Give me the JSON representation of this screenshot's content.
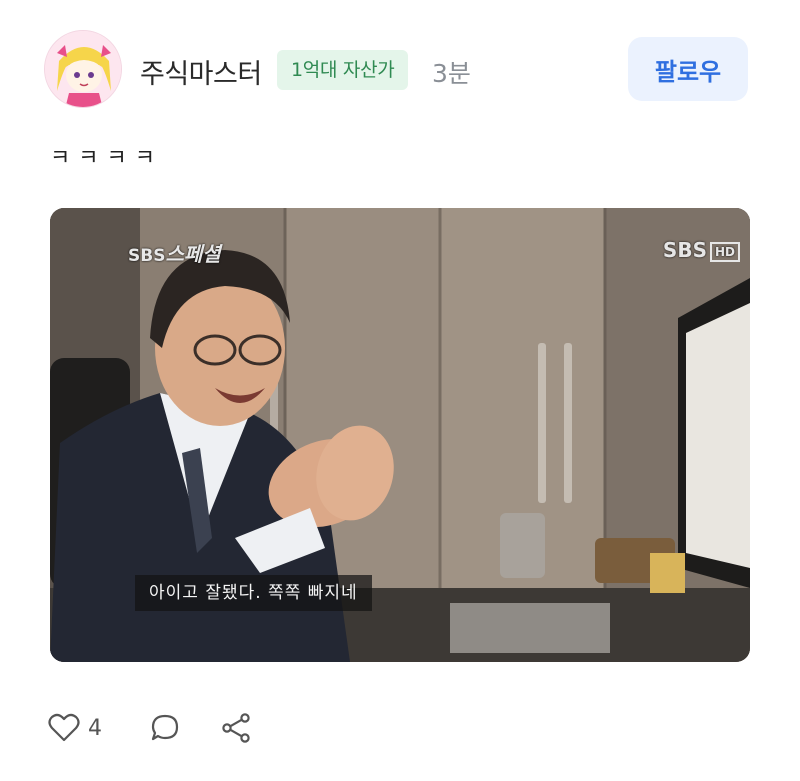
{
  "post": {
    "author": "주식마스터",
    "badge": "1억대 자산가",
    "time": "3분",
    "follow_label": "팔로우",
    "text": "ㅋㅋㅋㅋ"
  },
  "media": {
    "logo_left_main": "SBS",
    "logo_left_script": "스페셜",
    "logo_right_main": "SBS",
    "logo_right_hd": "HD",
    "subtitle": "아이고 잘됐다. 쪽쪽 빠지네"
  },
  "actions": {
    "like_count": "4",
    "like_icon": "heart-icon",
    "comment_icon": "comment-icon",
    "share_icon": "share-icon"
  },
  "colors": {
    "badge_bg": "#e4f5ea",
    "badge_text": "#2f8a52",
    "follow_bg": "#ebf2fe",
    "follow_text": "#2f6fe0"
  }
}
